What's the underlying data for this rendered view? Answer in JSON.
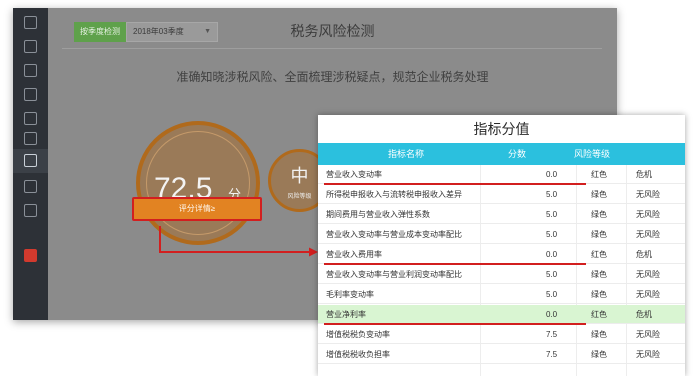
{
  "app": {
    "tab_label": "按季度检测",
    "period": "2018年03季度",
    "title": "税务风险检测",
    "subtitle": "准确知晓涉税风险、全面梳理涉税疑点，规范企业税务处理"
  },
  "score": {
    "value": "72.5",
    "unit": "分"
  },
  "risk": {
    "value": "中",
    "label": "风险等级"
  },
  "detail_button": "评分详情≥",
  "popup": {
    "title": "指标分值",
    "columns": [
      "指标名称",
      "分数",
      "风险等级"
    ],
    "rows": [
      {
        "name": "营业收入变动率",
        "score": "0.0",
        "color": "红色",
        "level": "危机"
      },
      {
        "name": "所得税申报收入与流转税申报收入差异",
        "score": "5.0",
        "color": "绿色",
        "level": "无风险"
      },
      {
        "name": "期间费用与营业收入弹性系数",
        "score": "5.0",
        "color": "绿色",
        "level": "无风险"
      },
      {
        "name": "营业收入变动率与营业成本变动率配比",
        "score": "5.0",
        "color": "绿色",
        "level": "无风险"
      },
      {
        "name": "营业收入费用率",
        "score": "0.0",
        "color": "红色",
        "level": "危机"
      },
      {
        "name": "营业收入变动率与营业利润变动率配比",
        "score": "5.0",
        "color": "绿色",
        "level": "无风险"
      },
      {
        "name": "毛利率变动率",
        "score": "5.0",
        "color": "绿色",
        "level": "无风险"
      },
      {
        "name": "营业净利率",
        "score": "0.0",
        "color": "红色",
        "level": "危机"
      },
      {
        "name": "增值税税负变动率",
        "score": "7.5",
        "color": "绿色",
        "level": "无风险"
      },
      {
        "name": "增值税税收负担率",
        "score": "7.5",
        "color": "绿色",
        "level": "无风险"
      }
    ]
  },
  "colors": {
    "header": "#2bc0de",
    "highlight": "#d9f5d2",
    "marker": "#d21f1f",
    "accent": "#e28322"
  }
}
